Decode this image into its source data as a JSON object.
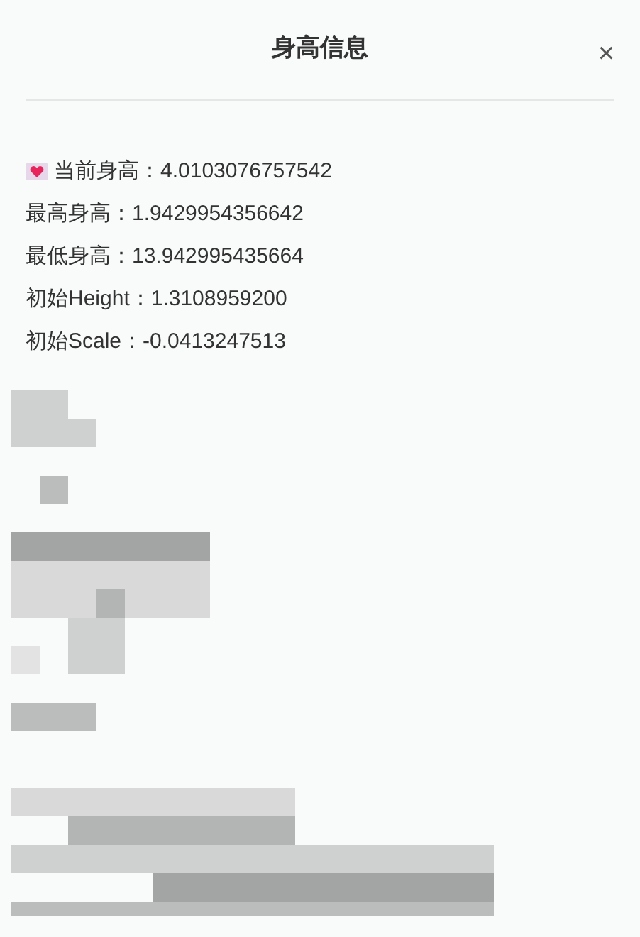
{
  "dialog": {
    "title": "身高信息",
    "close": "×"
  },
  "lines": [
    {
      "text": "当前身高：4.0103076757542",
      "kind": "icon_line"
    },
    {
      "text": "最高身高：1.9429954356642"
    },
    {
      "text": "最低身高：13.942995435664"
    },
    {
      "text": "初始Height：1.3108959200"
    },
    {
      "text": "初始Scale：-0.0413247513"
    }
  ]
}
